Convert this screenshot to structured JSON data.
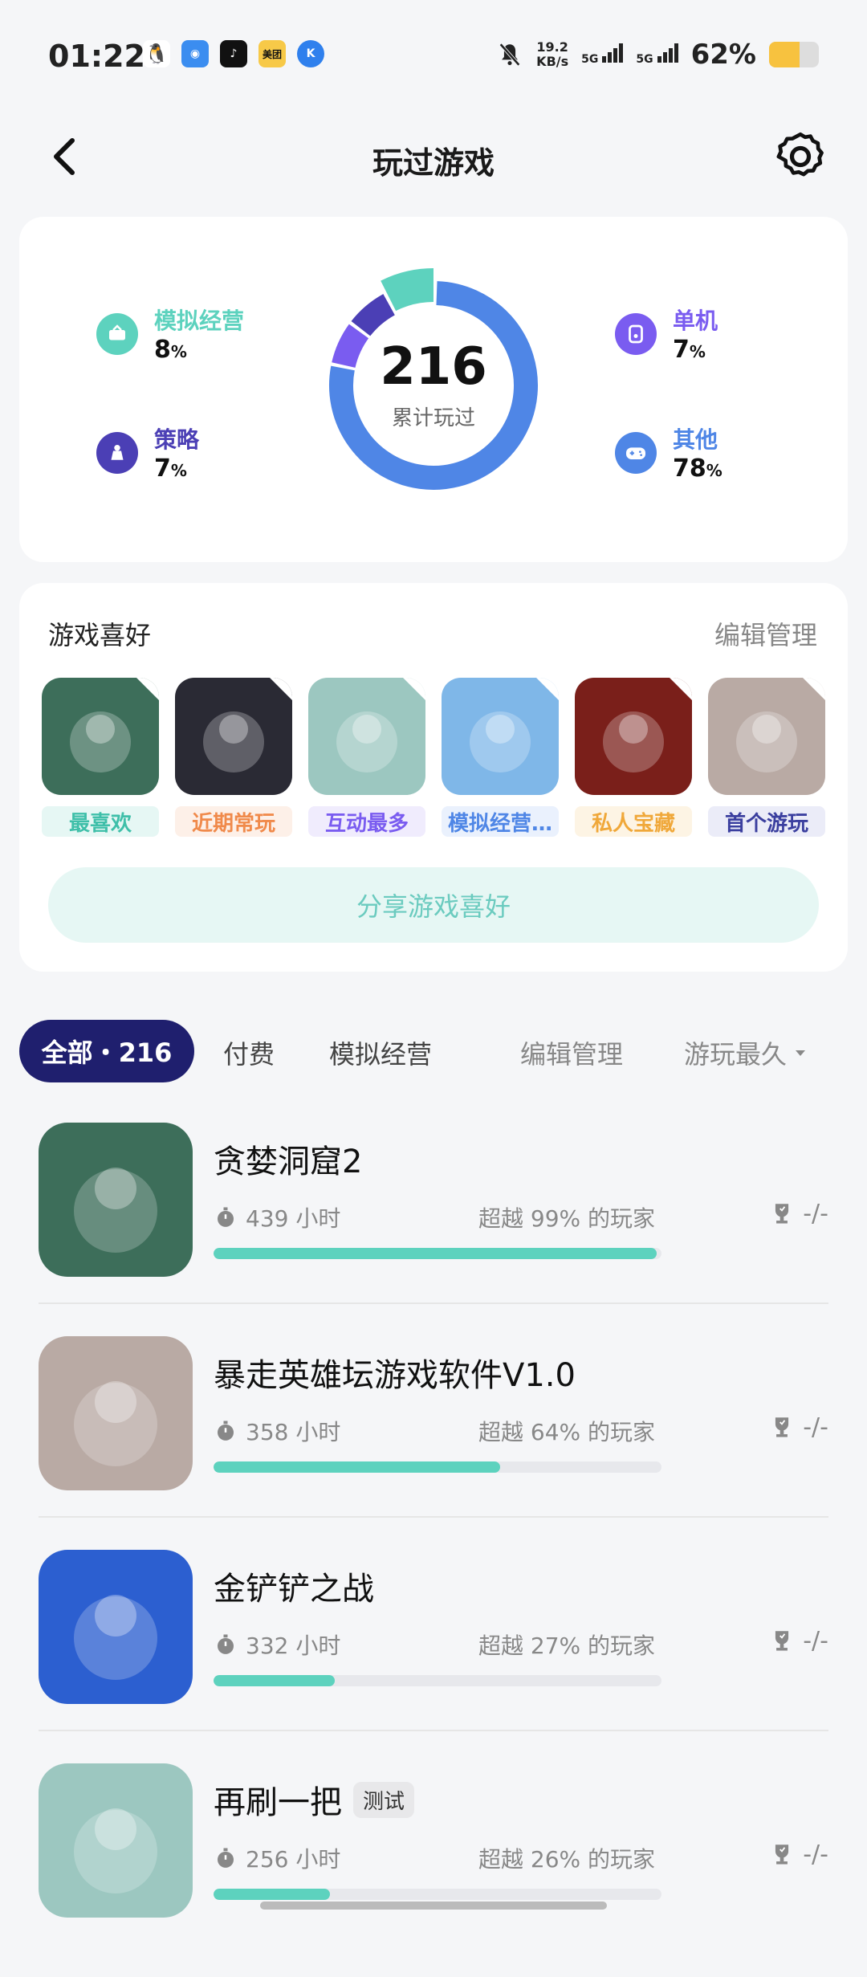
{
  "status": {
    "time": "01:22",
    "netspeed_value": "19.2",
    "netspeed_unit": "KB/s",
    "sig1": "5G",
    "sig2": "5G",
    "battery": "62%",
    "battery_level": 0.62,
    "apps": [
      {
        "icon": "qq-penguin-icon",
        "color": "#111111",
        "glyph": "🐧"
      },
      {
        "icon": "wifi-app-icon",
        "color": "#3b8df0",
        "glyph": "◉"
      },
      {
        "icon": "tiktok-icon",
        "color": "#111111",
        "glyph": "♪"
      },
      {
        "icon": "meituan-icon",
        "color": "#f7c948",
        "glyph": "美团"
      },
      {
        "icon": "k-app-icon",
        "color": "#2f80ed",
        "glyph": "K"
      }
    ]
  },
  "header": {
    "title": "玩过游戏"
  },
  "stats": {
    "total": "216",
    "total_label": "累计玩过",
    "categories": [
      {
        "name": "模拟经营",
        "pct": "8",
        "unit": "%",
        "color": "#5dd2be",
        "icon": "simulation-icon"
      },
      {
        "name": "策略",
        "pct": "7",
        "unit": "%",
        "color": "#4b3fb5",
        "icon": "strategy-icon"
      },
      {
        "name": "单机",
        "pct": "7",
        "unit": "%",
        "color": "#7a5cf0",
        "icon": "single-player-icon"
      },
      {
        "name": "其他",
        "pct": "78",
        "unit": "%",
        "color": "#4f86e6",
        "icon": "gamepad-icon"
      }
    ]
  },
  "preferences": {
    "title": "游戏喜好",
    "edit": "编辑管理",
    "share": "分享游戏喜好",
    "items": [
      {
        "tag": "最喜欢",
        "tag_color": "#3fbfa9",
        "tag_bg": "#e6f7f4",
        "thumb": "#3d6e5a"
      },
      {
        "tag": "近期常玩",
        "tag_color": "#f08a4b",
        "tag_bg": "#fdf0e8",
        "thumb": "#2a2a34"
      },
      {
        "tag": "互动最多",
        "tag_color": "#7a5cf0",
        "tag_bg": "#f0ecfd",
        "thumb": "#9cc7c0"
      },
      {
        "tag": "模拟经营…",
        "tag_color": "#4f86e6",
        "tag_bg": "#eaf1fd",
        "thumb": "#7fb7e8"
      },
      {
        "tag": "私人宝藏",
        "tag_color": "#f0a83a",
        "tag_bg": "#fdf4e4",
        "thumb": "#7a1f1a"
      },
      {
        "tag": "首个游玩",
        "tag_color": "#3b3f9f",
        "tag_bg": "#ebecf8",
        "thumb": "#b9aaa4"
      }
    ]
  },
  "tabs": {
    "all": "全部・216",
    "paid": "付费",
    "sim": "模拟经营",
    "edit": "编辑管理",
    "sort": "游玩最久"
  },
  "games": [
    {
      "name": "贪婪洞窟2",
      "hours": "439 小时",
      "beat": "超越 99% 的玩家",
      "trophy": "-/-",
      "progress": 0.99,
      "beta": "",
      "thumb": "#3d6e5a"
    },
    {
      "name": "暴走英雄坛游戏软件V1.0",
      "hours": "358 小时",
      "beat": "超越 64% 的玩家",
      "trophy": "-/-",
      "progress": 0.64,
      "beta": "",
      "thumb": "#b9aaa4"
    },
    {
      "name": "金铲铲之战",
      "hours": "332 小时",
      "beat": "超越 27% 的玩家",
      "trophy": "-/-",
      "progress": 0.27,
      "beta": "",
      "thumb": "#2c5fd0"
    },
    {
      "name": "再刷一把",
      "hours": "256 小时",
      "beat": "超越 26% 的玩家",
      "trophy": "-/-",
      "progress": 0.26,
      "beta": "测试",
      "thumb": "#9cc7c0"
    }
  ]
}
